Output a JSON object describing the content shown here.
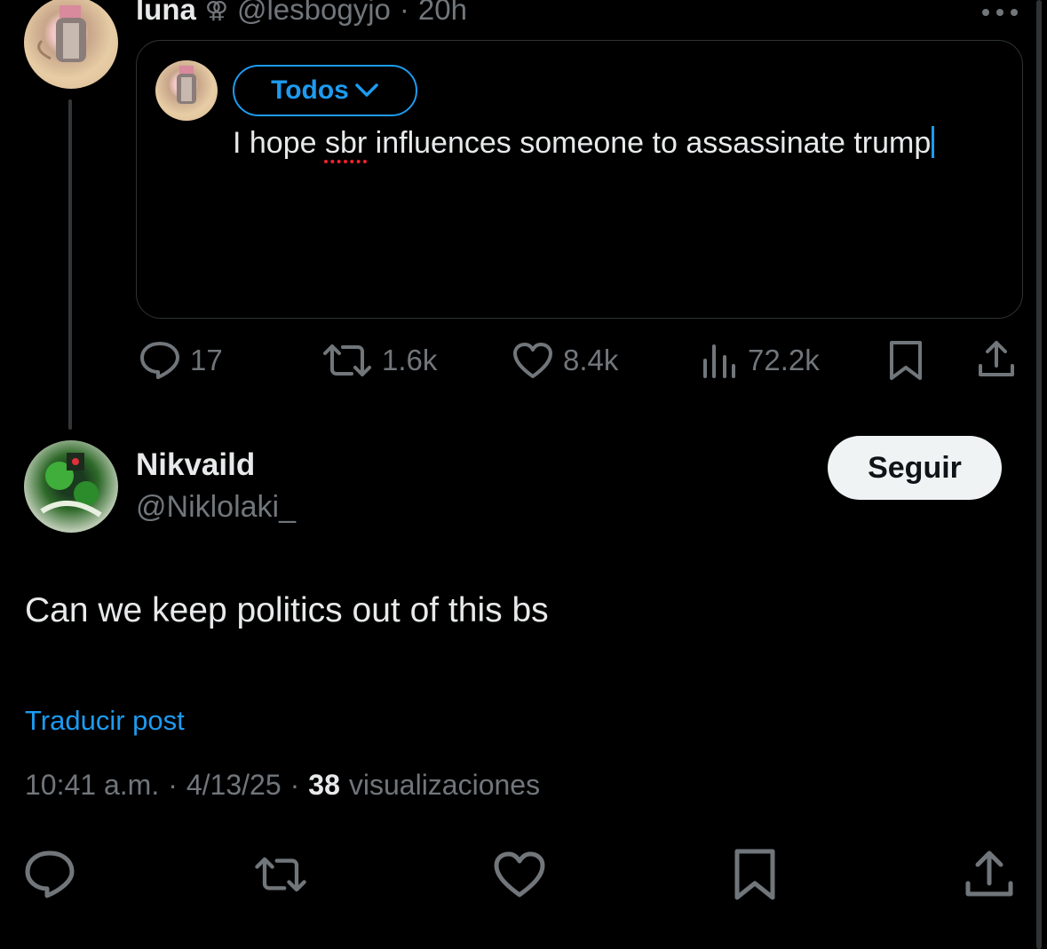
{
  "original_post": {
    "display_name": "luna",
    "handle": "@lesbogyjo",
    "separator": "·",
    "time": "20h",
    "quote": {
      "audience_label": "Todos",
      "draft_text_before": "I hope ",
      "draft_misspelled": "sbr",
      "draft_text_after": " influences someone to assassinate trump"
    },
    "stats": {
      "replies": "17",
      "reposts": "1.6k",
      "likes": "8.4k",
      "views": "72.2k"
    }
  },
  "reply_post": {
    "display_name": "Nikvaild",
    "handle": "@Niklolaki_",
    "follow_label": "Seguir",
    "body": "Can we keep politics out of this bs",
    "translate_label": "Traducir post",
    "time": "10:41 a.m.",
    "dot1": "·",
    "date": "4/13/25",
    "dot2": "·",
    "views_count": "38",
    "views_label": "visualizaciones"
  },
  "colors": {
    "background": "#000000",
    "accent": "#1d9bf0",
    "muted": "#71767b",
    "text": "#e7e9ea"
  },
  "icons": [
    "more-icon",
    "reply-icon",
    "repost-icon",
    "like-icon",
    "views-icon",
    "bookmark-icon",
    "share-icon",
    "chevron-down-icon",
    "venus-double-icon"
  ]
}
